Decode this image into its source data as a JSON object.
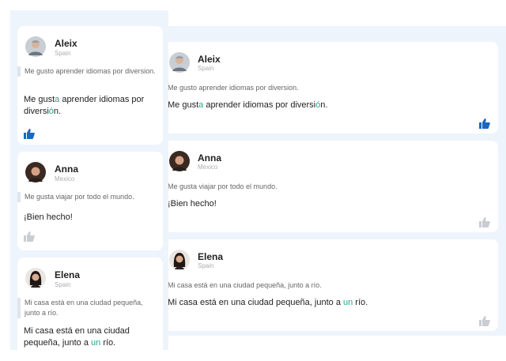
{
  "colors": {
    "panel_bg": "#eef4fb",
    "card_bg": "#ffffff",
    "highlight": "#22a88a",
    "like_active": "#1d67c0",
    "like_inactive": "#c9cdd3",
    "quote_bar": "#dfe4ea"
  },
  "icons": {
    "like": "thumbs-up-icon"
  },
  "corrections": [
    {
      "name": "Aleix",
      "country": "Spain",
      "original": "Me gusto aprender idiomas por diversion.",
      "correction_parts": [
        "Me gust",
        "a",
        " aprender idiomas por diversi",
        "ó",
        "n."
      ],
      "liked": true
    },
    {
      "name": "Anna",
      "country": "Mexico",
      "original": "Me gusta viajar por todo el mundo.",
      "correction_parts": [
        "¡Bien hecho!"
      ],
      "liked": false
    },
    {
      "name": "Elena",
      "country": "Spain",
      "original": "Mi casa está en una ciudad pequeña, junto a río.",
      "correction_parts": [
        "Mi casa está en una ciudad pequeña, junto a ",
        "un",
        " río."
      ],
      "liked": false
    }
  ]
}
